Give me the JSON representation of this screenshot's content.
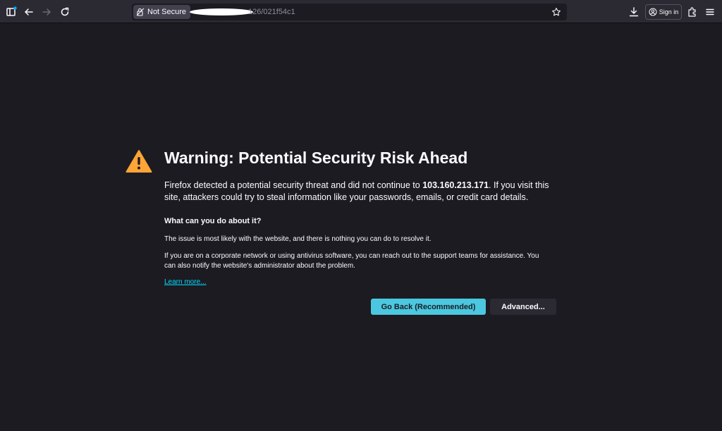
{
  "toolbar": {
    "not_secure_label": "Not Secure",
    "url_visible": "126/021f54c1",
    "signin_label": "Sign in"
  },
  "page": {
    "title": "Warning: Potential Security Risk Ahead",
    "intro_before": "Firefox detected a potential security threat and did not continue to ",
    "intro_host": "103.160.213.171",
    "intro_after": ". If you visit this site, attackers could try to steal information like your passwords, emails, or credit card details.",
    "subheading": "What can you do about it?",
    "paragraph1": "The issue is most likely with the website, and there is nothing you can do to resolve it.",
    "paragraph2": "If you are on a corporate network or using antivirus software, you can reach out to the support teams for assistance. You can also notify the website's administrator about the problem.",
    "learn_more": "Learn more...",
    "go_back_label": "Go Back (Recommended)",
    "advanced_label": "Advanced..."
  },
  "colors": {
    "background": "#1c1b22",
    "toolbar": "#2b2a33",
    "accent": "#4bc8e0",
    "warning": "#ffa436",
    "link": "#00ddff"
  },
  "icons": [
    "sidebar-icon",
    "back-icon",
    "forward-icon",
    "reload-icon",
    "lock-warning-icon",
    "bookmark-star-icon",
    "download-icon",
    "account-icon",
    "extensions-icon",
    "menu-icon",
    "warning-icon"
  ]
}
